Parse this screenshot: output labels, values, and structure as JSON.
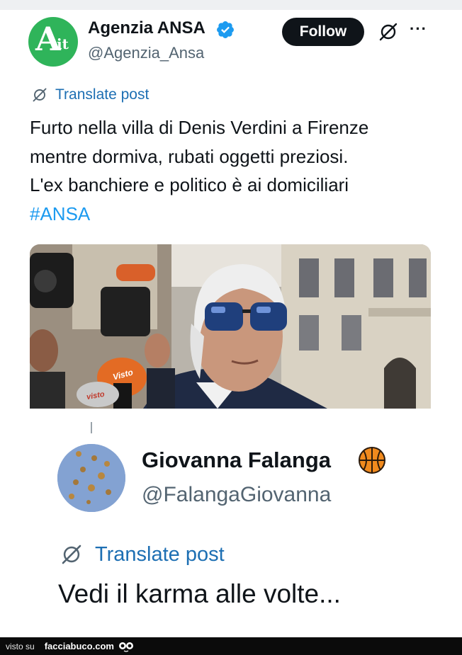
{
  "post": {
    "author": {
      "name": "Agenzia ANSA",
      "handle": "@Agenzia_Ansa",
      "avatar_text": "A",
      "avatar_sub": "it",
      "avatar_color": "#2fb45a",
      "verified": true
    },
    "follow_label": "Follow",
    "translate_label": "Translate post",
    "text_lines": [
      "Furto nella villa di Denis Verdini a Firenze",
      "mentre dormiva, rubati oggetti preziosi.",
      "L'ex banchiere e politico è ai domiciliari"
    ],
    "hashtag": "#ANSA",
    "photo": {
      "mic_labels": [
        "Visto",
        "visto"
      ]
    }
  },
  "reply": {
    "author": {
      "name": "Giovanna Falanga",
      "handle": "@FalangaGiovanna",
      "badge_icon": "basketball-icon"
    },
    "translate_label": "Translate post",
    "text": "Vedi il karma alle volte..."
  },
  "footer": {
    "visto_label": "visto su",
    "site_label": "facciabuco.com"
  },
  "colors": {
    "link_blue": "#1d9bf0",
    "translate_blue": "#1d6fb3",
    "text_dark": "#0f1419",
    "text_gray": "#536471"
  }
}
